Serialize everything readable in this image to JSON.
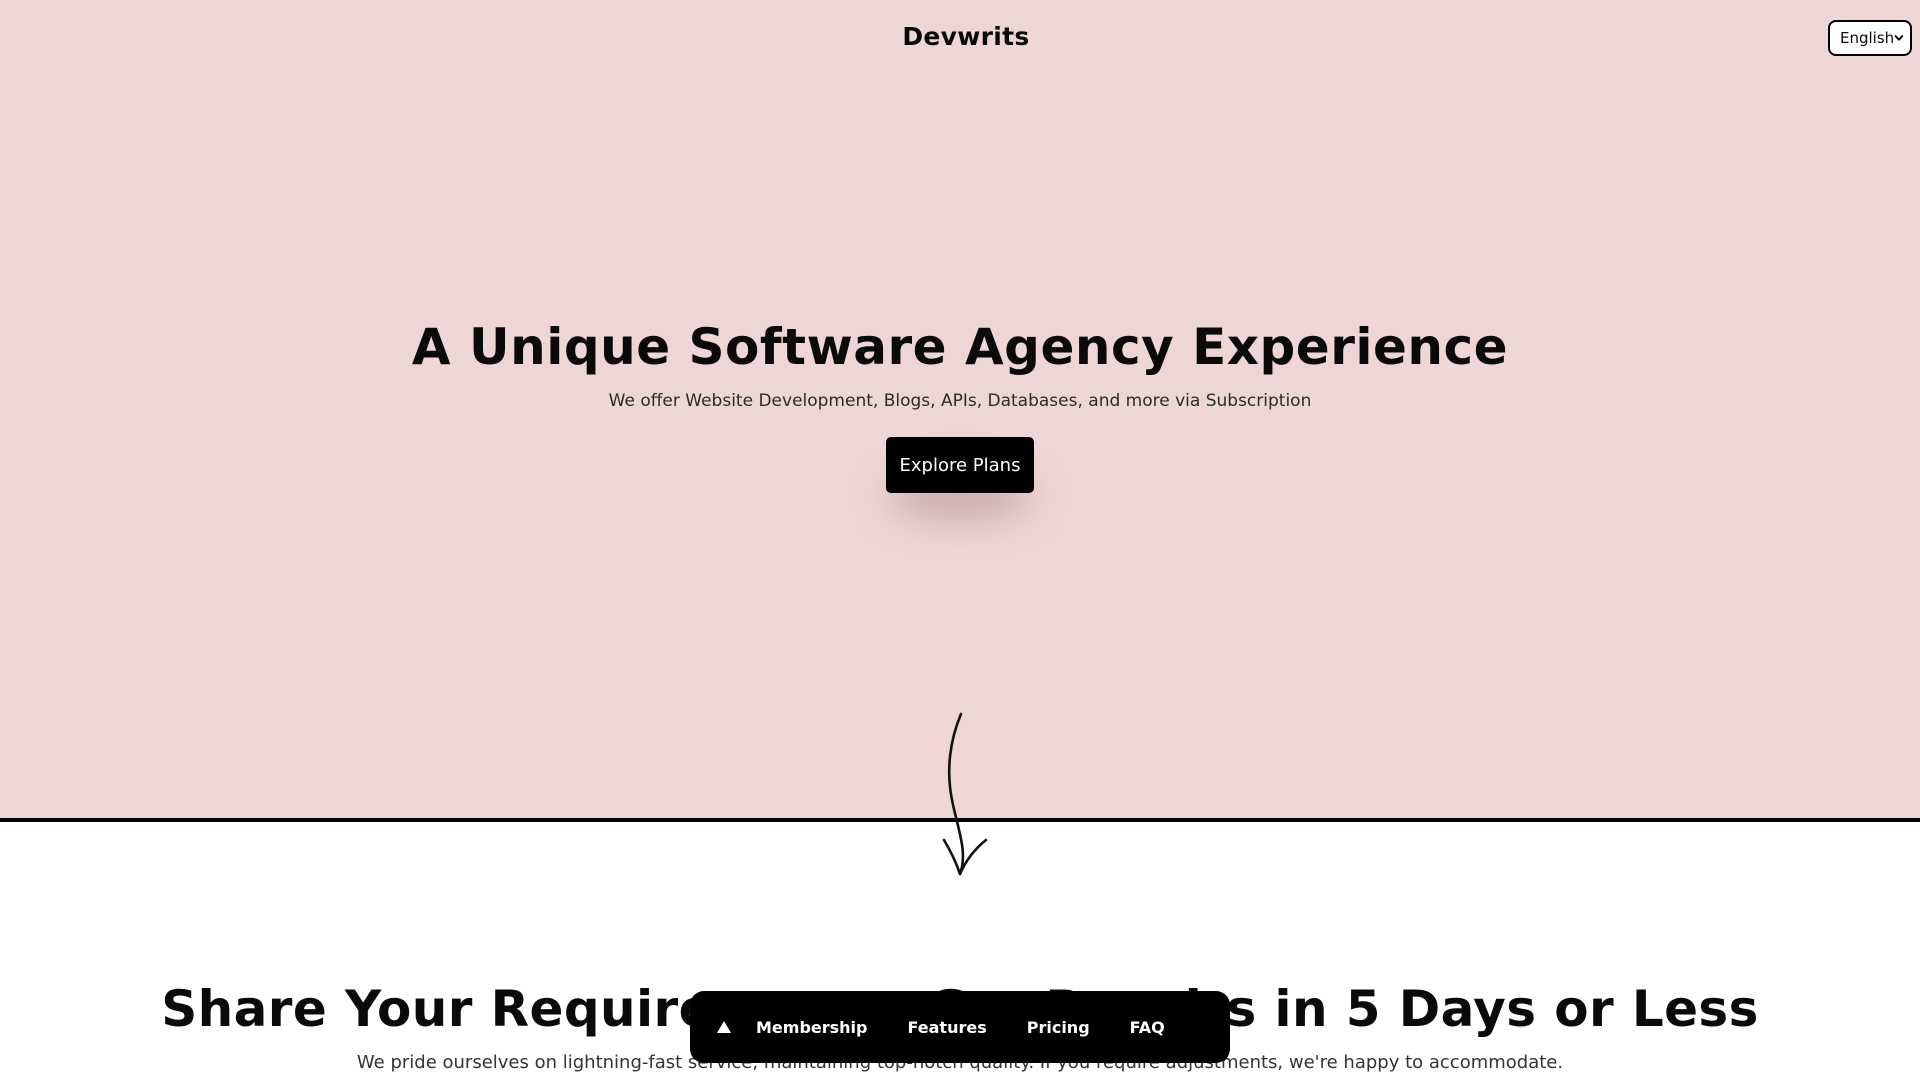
{
  "header": {
    "brand": "Devwrits",
    "language": {
      "selected": "English"
    }
  },
  "hero": {
    "title": "A Unique Software Agency Experience",
    "subtitle": "We offer Website Development, Blogs, APIs, Databases, and more via Subscription",
    "cta_label": "Explore Plans",
    "background_color": "#efd6d6"
  },
  "section2": {
    "title": "Share Your Requirements, Get Results in 5 Days or Less",
    "subtitle": "We pride ourselves on lightning-fast service, maintaining top-notch quality. If you require adjustments, we're happy to accommodate."
  },
  "bottom_nav": {
    "up_icon": "triangle-up-icon",
    "items": [
      {
        "label": "Membership"
      },
      {
        "label": "Features"
      },
      {
        "label": "Pricing"
      },
      {
        "label": "FAQ"
      }
    ]
  }
}
